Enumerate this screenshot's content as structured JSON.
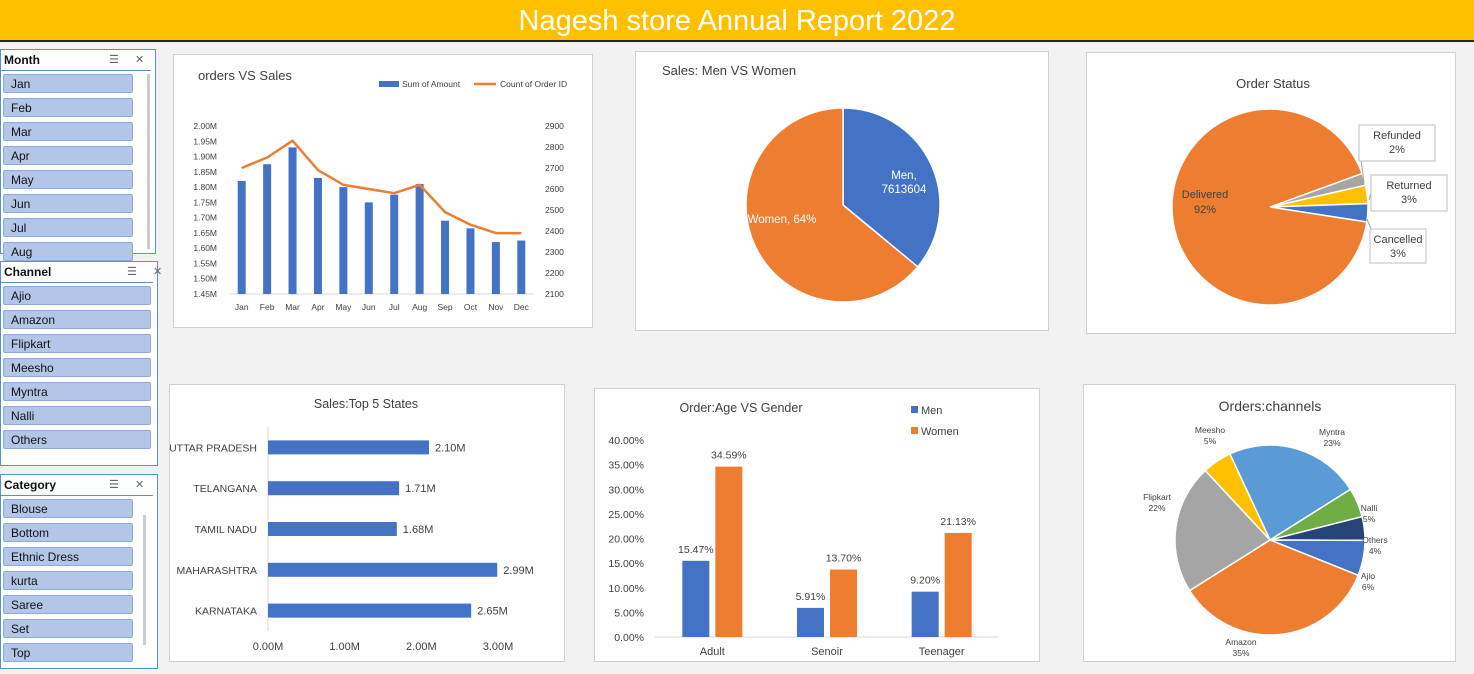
{
  "title": "Nagesh store Annual Report 2022",
  "slicers": {
    "month": {
      "title": "Month",
      "items": [
        "Jan",
        "Feb",
        "Mar",
        "Apr",
        "May",
        "Jun",
        "Jul",
        "Aug"
      ]
    },
    "channel": {
      "title": "Channel",
      "items": [
        "Ajio",
        "Amazon",
        "Flipkart",
        "Meesho",
        "Myntra",
        "Nalli",
        "Others"
      ]
    },
    "category": {
      "title": "Category",
      "items": [
        "Blouse",
        "Bottom",
        "Ethnic Dress",
        "kurta",
        "Saree",
        "Set",
        "Top"
      ]
    }
  },
  "chart_data": [
    {
      "id": "orders_vs_sales",
      "type": "bar",
      "title": "orders VS Sales",
      "categories": [
        "Jan",
        "Feb",
        "Mar",
        "Apr",
        "May",
        "Jun",
        "Jul",
        "Aug",
        "Sep",
        "Oct",
        "Nov",
        "Dec"
      ],
      "series": [
        {
          "name": "Sum of Amount",
          "type": "bar",
          "color": "#4472c4",
          "values": [
            1.82,
            1.875,
            1.93,
            1.83,
            1.8,
            1.75,
            1.775,
            1.81,
            1.69,
            1.665,
            1.62,
            1.625
          ]
        },
        {
          "name": "Count of Order ID",
          "type": "line",
          "axis": "right",
          "color": "#ed7d31",
          "values": [
            2700,
            2750,
            2830,
            2690,
            2620,
            2600,
            2580,
            2620,
            2490,
            2430,
            2390,
            2390
          ]
        }
      ],
      "left_ticks": [
        "1.45M",
        "1.50M",
        "1.55M",
        "1.60M",
        "1.65M",
        "1.70M",
        "1.75M",
        "1.80M",
        "1.85M",
        "1.90M",
        "1.95M",
        "2.00M"
      ],
      "right_ticks": [
        "2100",
        "2200",
        "2300",
        "2400",
        "2500",
        "2600",
        "2700",
        "2800",
        "2900"
      ],
      "ylim": [
        1.45,
        2.0
      ],
      "y2lim": [
        2100,
        2900
      ],
      "legend": "top-right"
    },
    {
      "id": "men_vs_women",
      "type": "pie",
      "title": "Sales: Men VS Women",
      "slices": [
        {
          "label": "Men",
          "value": 36,
          "display": "Men,\n7613604",
          "color": "#4472c4"
        },
        {
          "label": "Women",
          "value": 64,
          "display": "Women, 64%",
          "color": "#ed7d31"
        }
      ]
    },
    {
      "id": "order_status",
      "type": "pie",
      "title": "Order Status",
      "slices": [
        {
          "label": "Refunded",
          "value": 2,
          "display": "2%",
          "color": "#a5a5a5"
        },
        {
          "label": "Returned",
          "value": 3,
          "display": "3%",
          "color": "#ffc000"
        },
        {
          "label": "Cancelled",
          "value": 3,
          "display": "3%",
          "color": "#4472c4"
        },
        {
          "label": "Delivered",
          "value": 92,
          "display": "92%",
          "color": "#ed7d31"
        }
      ]
    },
    {
      "id": "top_states",
      "type": "bar",
      "orientation": "horizontal",
      "title": "Sales:Top 5 States",
      "categories": [
        "UTTAR PRADESH",
        "TELANGANA",
        "TAMIL NADU",
        "MAHARASHTRA",
        "KARNATAKA"
      ],
      "values": [
        2.1,
        1.71,
        1.68,
        2.99,
        2.65
      ],
      "labels": [
        "2.10M",
        "1.71M",
        "1.68M",
        "2.99M",
        "2.65M"
      ],
      "xticks": [
        "0.00M",
        "1.00M",
        "2.00M",
        "3.00M"
      ],
      "xlim": [
        0,
        3.0
      ],
      "color": "#4472c4"
    },
    {
      "id": "age_vs_gender",
      "type": "bar",
      "title": "Order:Age VS Gender",
      "categories": [
        "Adult",
        "Senoir",
        "Teenager"
      ],
      "series": [
        {
          "name": "Men",
          "color": "#4472c4",
          "values": [
            15.47,
            5.91,
            9.2
          ],
          "labels": [
            "15.47%",
            "5.91%",
            "9.20%"
          ]
        },
        {
          "name": "Women",
          "color": "#ed7d31",
          "values": [
            34.59,
            13.7,
            21.13
          ],
          "labels": [
            "34.59%",
            "13.70%",
            "21.13%"
          ]
        }
      ],
      "yticks": [
        "0.00%",
        "5.00%",
        "10.00%",
        "15.00%",
        "20.00%",
        "25.00%",
        "30.00%",
        "35.00%",
        "40.00%"
      ],
      "ylim": [
        0,
        40
      ],
      "legend": "top-right"
    },
    {
      "id": "orders_channels",
      "type": "pie",
      "title": "Orders:channels",
      "slices": [
        {
          "label": "Myntra",
          "value": 23,
          "display": "23%",
          "color": "#5b9bd5"
        },
        {
          "label": "Nalli",
          "value": 5,
          "display": "5%",
          "color": "#70ad47"
        },
        {
          "label": "Others",
          "value": 4,
          "display": "4%",
          "color": "#264478"
        },
        {
          "label": "Ajio",
          "value": 6,
          "display": "6%",
          "color": "#4472c4"
        },
        {
          "label": "Amazon",
          "value": 35,
          "display": "35%",
          "color": "#ed7d31"
        },
        {
          "label": "Flipkart",
          "value": 22,
          "display": "22%",
          "color": "#a5a5a5"
        },
        {
          "label": "Meesho",
          "value": 5,
          "display": "5%",
          "color": "#ffc000"
        }
      ]
    }
  ]
}
